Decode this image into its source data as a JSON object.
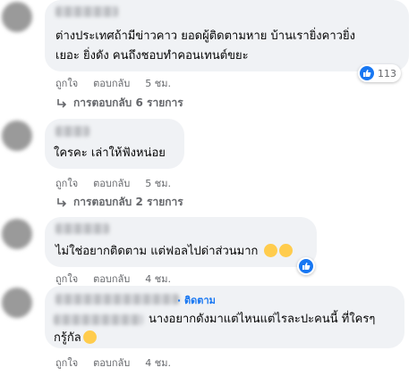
{
  "comments": [
    {
      "text_lines": [
        "ต่างประเทศถ้ามีข่าวคาว ยอดผู้ติดตามหาย บ้านเรายิ่งคาวยิ่ง",
        "เยอะ ยิ่งดัง คนถึงชอบทำคอนเทนต์ขยะ"
      ],
      "reaction_count": "113",
      "like_label": "ถูกใจ",
      "reply_label": "ตอบกลับ",
      "time": "5 ชม.",
      "replies_label": "การตอบกลับ 6 รายการ"
    },
    {
      "text": "ใครคะ เล่าให้ฟังหน่อย",
      "like_label": "ถูกใจ",
      "reply_label": "ตอบกลับ",
      "time": "5 ชม.",
      "replies_label": "การตอบกลับ 2 รายการ"
    },
    {
      "text": "ไม่ใช่อยากติดตาม แต่ฟอลไปด่าส่วนมาก",
      "like_label": "ถูกใจ",
      "reply_label": "ตอบกลับ",
      "time": "4 ชม."
    },
    {
      "follow_label": "ติดตาม",
      "text_lines": [
        "นางอยากดังมาแต่ไหนแต่ไรละปะคนนี้ ที่ใครๆ",
        "กรู้กัล"
      ],
      "like_label": "ถูกใจ",
      "reply_label": "ตอบกลับ",
      "time": "4 ชม."
    }
  ],
  "colors": {
    "bubble": "#f0f2f5",
    "link": "#1877f2",
    "meta": "#65676b"
  }
}
